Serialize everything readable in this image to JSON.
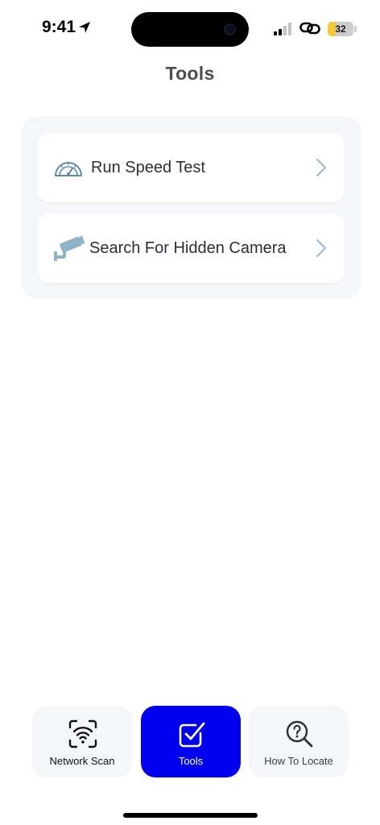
{
  "status_bar": {
    "time": "9:41",
    "battery_level": "32",
    "battery_fraction": 0.32,
    "battery_color": "#f5c936",
    "signal_bars_active": 2,
    "icons": [
      "location-arrow-icon",
      "signal-icon",
      "link-icon",
      "battery-icon"
    ]
  },
  "header": {
    "title": "Tools"
  },
  "tools": [
    {
      "label": "Run Speed Test",
      "icon": "speedometer-icon"
    },
    {
      "label": "Search For Hidden Camera",
      "icon": "security-camera-icon"
    }
  ],
  "tab_bar": {
    "active_color": "#0000ee",
    "tabs": [
      {
        "label": "Network Scan",
        "icon": "wifi-scan-icon",
        "active": false
      },
      {
        "label": "Tools",
        "icon": "checkbox-icon",
        "active": true
      },
      {
        "label": "How To Locate",
        "icon": "magnifier-question-icon",
        "active": false
      }
    ]
  }
}
